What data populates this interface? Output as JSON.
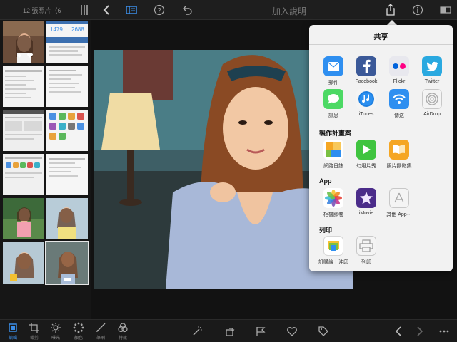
{
  "sidebar": {
    "count_label": "12 張照片（6"
  },
  "toolbar": {
    "title": "加入說明"
  },
  "share": {
    "title": "共享",
    "row1": [
      "郵件",
      "Facebook",
      "Flickr",
      "Twitter"
    ],
    "row2": [
      "訊息",
      "iTunes",
      "傳送",
      "AirDrop"
    ],
    "section_project": "製作計畫案",
    "row3": [
      "網路日誌",
      "幻燈片秀",
      "照片攝影集"
    ],
    "section_app": "App",
    "row4": [
      "相機膠卷",
      "iMovie",
      "其他 App⋯"
    ],
    "section_print": "列印",
    "row5": [
      "訂購線上沖印",
      "列印"
    ]
  },
  "tools": [
    "裁剪",
    "曝光",
    "顏色",
    "筆刷",
    "特效"
  ],
  "tool_active": "編輯",
  "thumb_stats": [
    "1479",
    "2688"
  ],
  "colors": {
    "accent": "#3b8ee8",
    "bar": "#1e1e1e",
    "popover": "#f2f2f2"
  }
}
